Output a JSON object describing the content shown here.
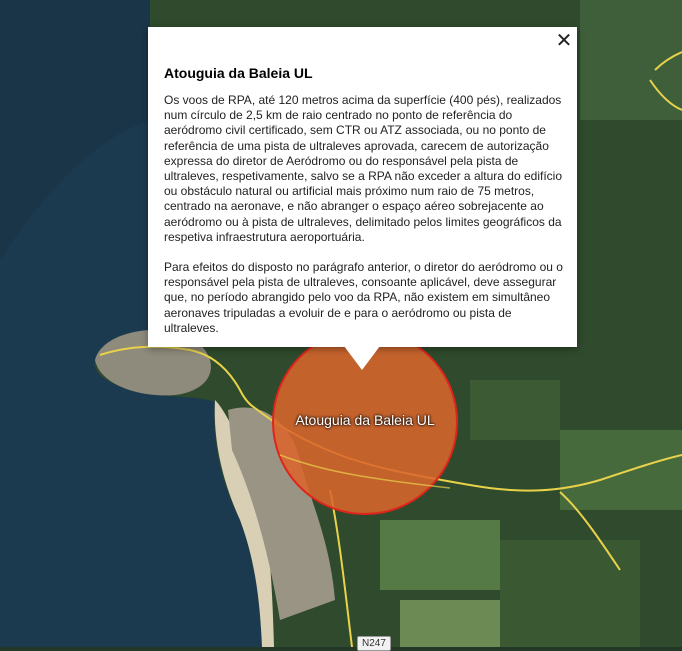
{
  "popup": {
    "title": "Atouguia da Baleia UL",
    "paragraphs": [
      "Os voos de RPA, até 120 metros acima da superfície (400 pés), realizados num círculo de 2,5 km de raio centrado no ponto de referência do aeródromo civil certificado, sem CTR ou ATZ associada, ou no ponto de referência de uma pista de ultraleves aprovada, carecem de autorização expressa do diretor de Aeródromo ou do responsável pela pista de ultraleves, respetivamente, salvo se a RPA não exceder a altura do edifício ou obstáculo natural ou artificial mais próximo num raio de 75 metros, centrado na aeronave, e não abranger o espaço aéreo sobrejacente ao aeródromo ou à pista de ultraleves, delimitado pelos limites geográficos da respetiva infraestrutura aeroportuária.",
      "Para efeitos do disposto no parágrafo anterior, o diretor do aeródromo ou o responsável pela pista de ultraleves, consoante aplicável, deve assegurar que, no período abrangido pelo voo da RPA, não existem em simultâneo aeronaves tripuladas a evoluir de e para o aeródromo ou pista de ultraleves."
    ],
    "close_symbol": "✕"
  },
  "map": {
    "zone_label": "Atouguia da Baleia UL",
    "road_label": "N247",
    "zone_fill_color": "#d9652c",
    "zone_stroke_color": "#e0241b",
    "road_color": "#e8d24a",
    "sea_color": "#1c3a4f"
  }
}
